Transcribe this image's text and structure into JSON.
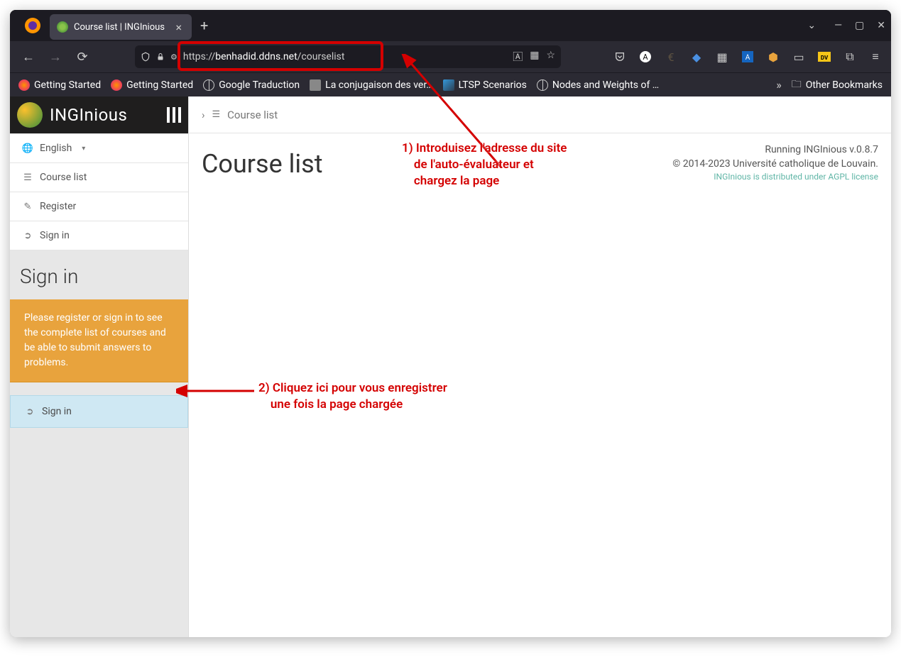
{
  "browser": {
    "tab_title": "Course list | INGInious",
    "url_prefix": "https://",
    "url_domain": "benhadid.ddns.net",
    "url_path": "/courselist"
  },
  "bookmarks": [
    {
      "label": "Getting Started",
      "fav": "ff"
    },
    {
      "label": "Getting Started",
      "fav": "ff"
    },
    {
      "label": "Google Traduction",
      "fav": "globe"
    },
    {
      "label": "La conjugaison des ver…",
      "fav": "pixel"
    },
    {
      "label": "LTSP Scenarios",
      "fav": "ltsp"
    },
    {
      "label": "Nodes and Weights of …",
      "fav": "globe"
    }
  ],
  "other_bookmarks_label": "Other Bookmarks",
  "sidebar": {
    "brand": "INGInious",
    "language_label": "English",
    "items": {
      "course_list": "Course list",
      "register": "Register",
      "sign_in": "Sign in"
    },
    "signin_header": "Sign in",
    "signin_notice": "Please register or sign in to see the complete list of courses and be able to submit answers to problems.",
    "signin_button": "Sign in"
  },
  "main": {
    "breadcrumb": "Course list",
    "title": "Course list",
    "footer_running": "Running INGInious v.0.8.7",
    "footer_copyright": "© 2014-2023 Université catholique de Louvain.",
    "footer_license": "INGInious is distributed under AGPL license"
  },
  "annotations": {
    "step1": "1) Introduisez l'adresse du site\n    de l'auto-évaluateur et\n    chargez la page",
    "step2": "2) Cliquez ici pour vous enregistrer\n    une fois la page chargée"
  }
}
